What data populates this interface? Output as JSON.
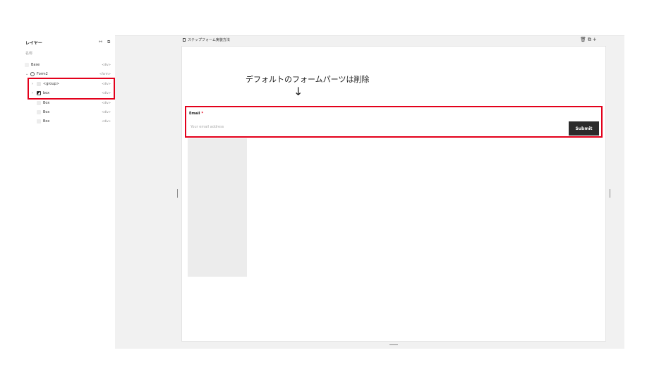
{
  "layers_panel": {
    "title": "レイヤー",
    "icons": [
      "link-icon",
      "copy-icon"
    ],
    "column_label": "名称",
    "rows": [
      {
        "label": "Base",
        "tag": "<div>"
      },
      {
        "label": "Form2",
        "tag": "<form>"
      },
      {
        "label": "<group>",
        "tag": "<div>"
      },
      {
        "label": "box",
        "tag": "<div>"
      },
      {
        "label": "Box",
        "tag": "<div>"
      },
      {
        "label": "Box",
        "tag": "<div>"
      },
      {
        "label": "Box",
        "tag": "<div>"
      }
    ]
  },
  "canvas": {
    "frame_title": "ステップフォーム実装方法",
    "tools": [
      "trash-icon",
      "duplicate-icon",
      "plus-icon"
    ]
  },
  "annotation": {
    "text": "デフォルトのフォームパーツは削除",
    "arrow": "↓"
  },
  "form": {
    "label": "Email",
    "required_mark": "*",
    "placeholder": "Your email address",
    "submit_label": "Submit"
  },
  "colors": {
    "highlight": "#e3001b",
    "button_bg": "#2b2b2b",
    "canvas_bg": "#f1f1f1"
  }
}
